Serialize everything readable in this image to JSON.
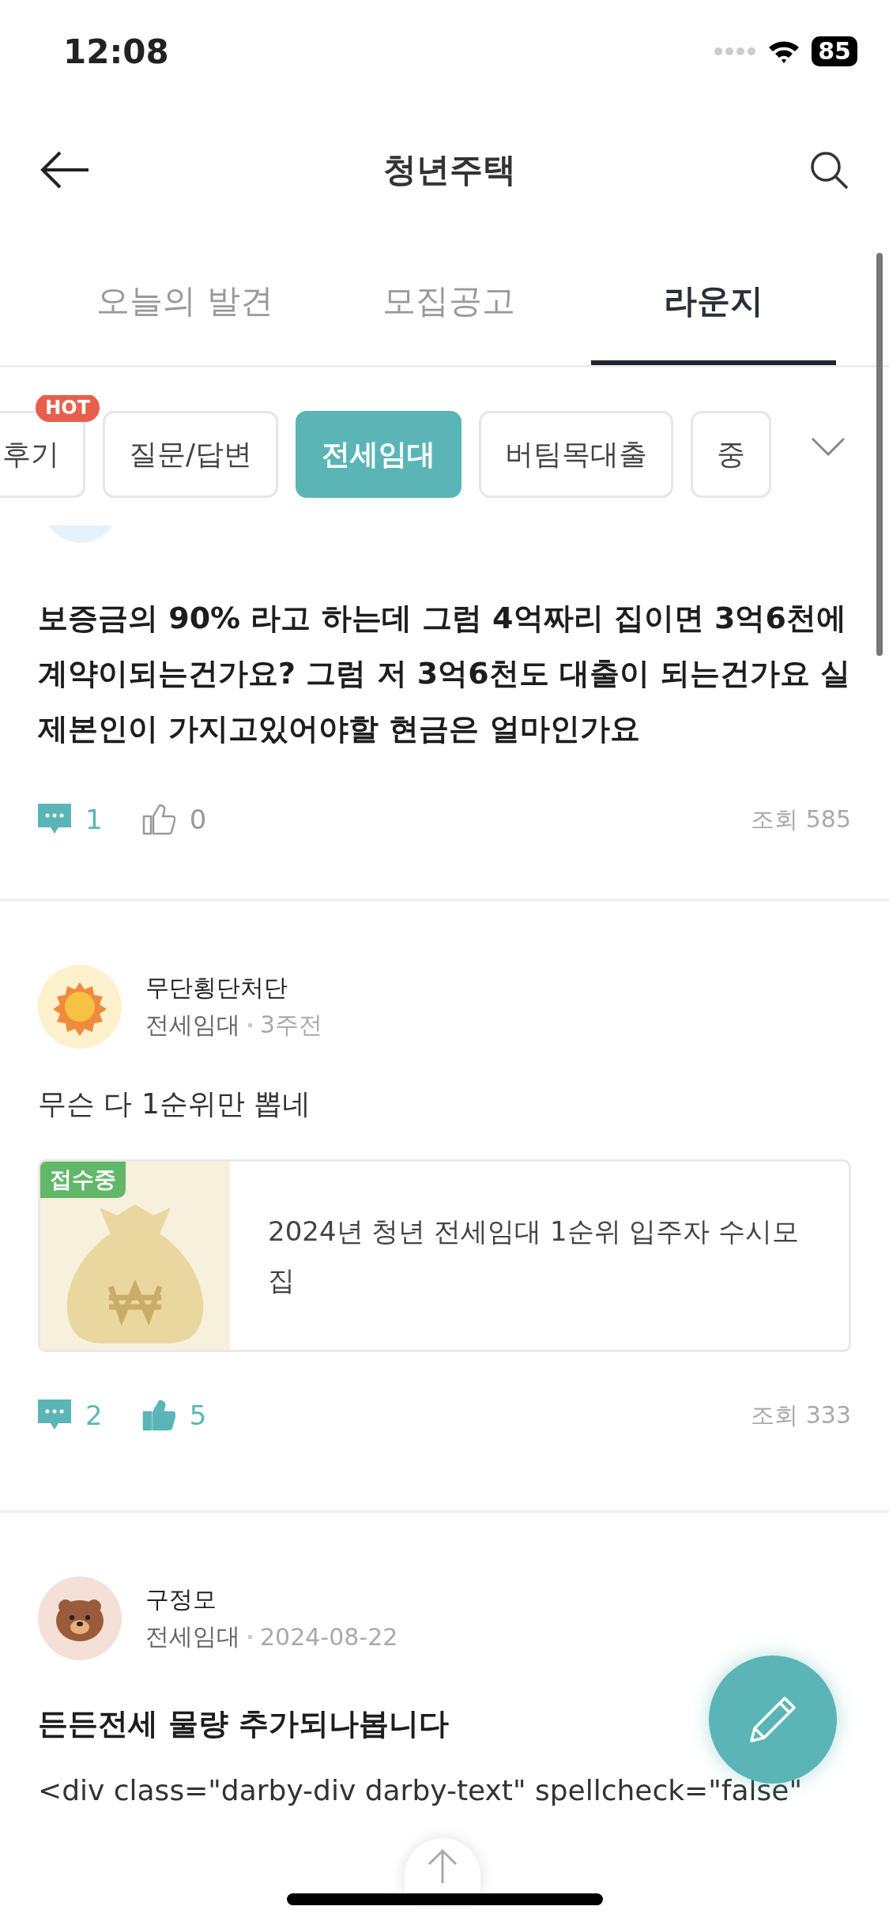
{
  "status_bar": {
    "time": "12:08",
    "battery": "85"
  },
  "nav": {
    "title": "청년주택"
  },
  "tabs": [
    {
      "label": "오늘의 발견",
      "selected": false
    },
    {
      "label": "모집공고",
      "selected": false
    },
    {
      "label": "라운지",
      "selected": true
    }
  ],
  "chips": [
    {
      "label": "후기",
      "selected": false,
      "badge": "HOT"
    },
    {
      "label": "질문/답변",
      "selected": false
    },
    {
      "label": "전세임대",
      "selected": true
    },
    {
      "label": "버팀목대출",
      "selected": false
    },
    {
      "label": "중",
      "selected": false
    }
  ],
  "posts": [
    {
      "avatar": {
        "kind": "plain"
      },
      "title": "보증금의 90% 라고 하는데 그럼 4억짜리 집이면 3억6천에 계약이되는건가요? 그럼 저 3억6천도 대출이 되는건가요 실제본인이 가지고있어야할 현금은 얼마인가요",
      "comments": "1",
      "likes": "0",
      "liked": false,
      "views": "조회 585"
    },
    {
      "avatar": {
        "kind": "sun"
      },
      "author": "무단횡단처단",
      "category": "전세임대",
      "time": "3주전",
      "body": "무슨 다 1순위만 뽑네",
      "link": {
        "badge": "접수중",
        "title": "2024년 청년 전세임대 1순위 입주자 수시모집"
      },
      "comments": "2",
      "likes": "5",
      "liked": true,
      "views": "조회 333"
    },
    {
      "avatar": {
        "kind": "bear"
      },
      "author": "구정모",
      "category": "전세임대",
      "time": "2024-08-22",
      "title": "든든전세 물량 추가되나봅니다",
      "body": "<div class=\"darby-div darby-text\" spellcheck=\"false\""
    }
  ]
}
